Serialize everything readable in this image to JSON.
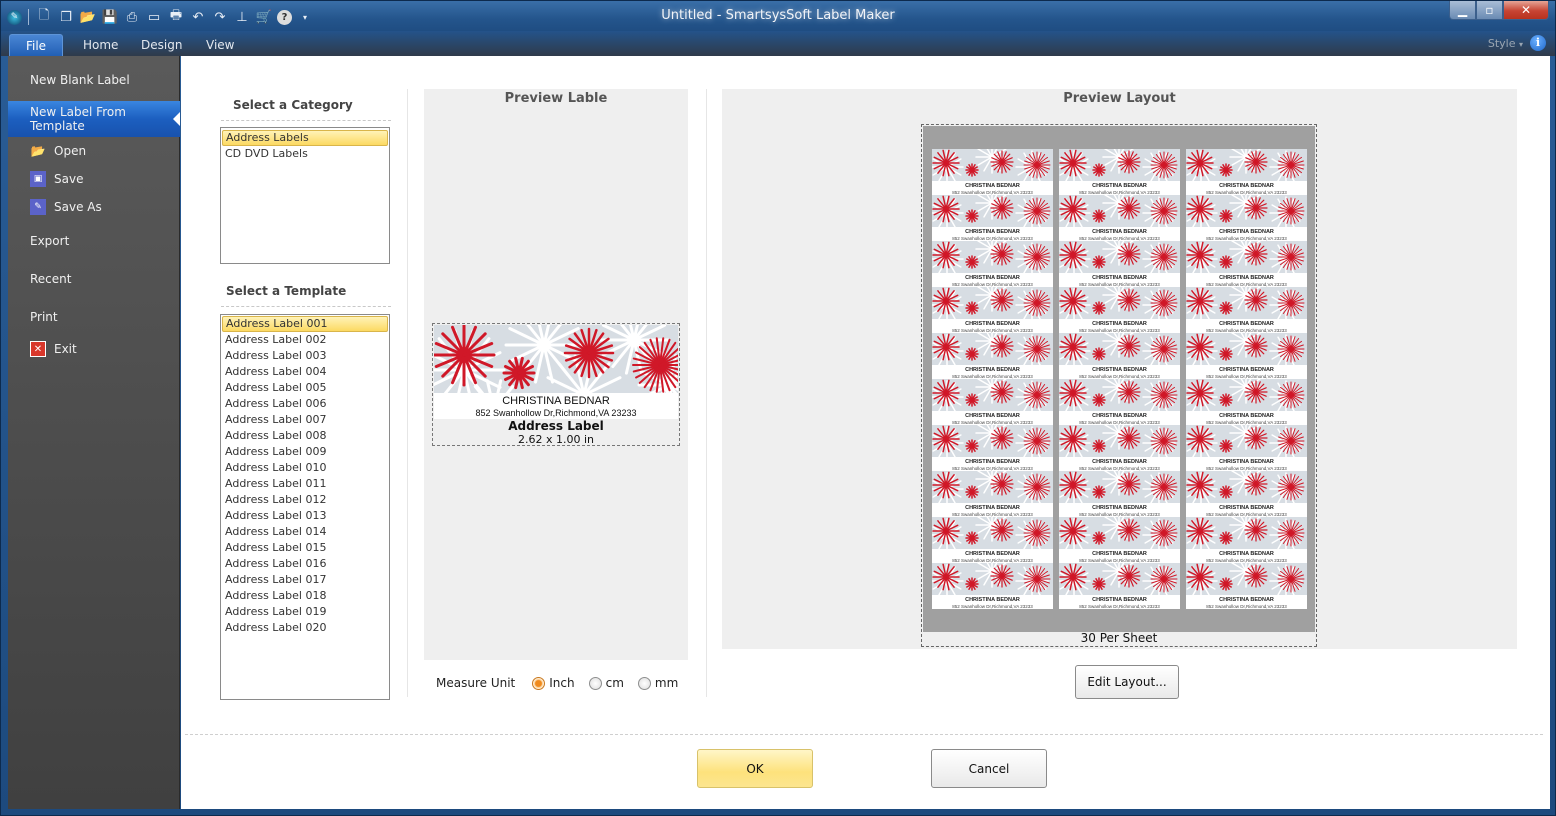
{
  "window": {
    "title": "Untitled - SmartsysSoft Label Maker",
    "controls": [
      "minimize",
      "maximize",
      "close"
    ]
  },
  "quick_access": {
    "icons": [
      "app-logo-icon",
      "new-icon",
      "new-from-template-icon",
      "open-icon",
      "save-icon",
      "pdf-icon",
      "label-icon",
      "print-icon",
      "undo-icon",
      "redo-icon",
      "stamp-icon",
      "cart-icon",
      "help-icon",
      "customize-dropdown-icon"
    ]
  },
  "ribbon": {
    "tabs": [
      {
        "label": "File",
        "active": true
      },
      {
        "label": "Home"
      },
      {
        "label": "Design"
      },
      {
        "label": "View"
      }
    ],
    "style_label": "Style",
    "info_glyph": "i"
  },
  "backstage": {
    "items": [
      {
        "label": "New Blank Label"
      },
      {
        "label": "New Label From Template",
        "active": true
      },
      {
        "label": "Open",
        "icon": "folder-icon"
      },
      {
        "label": "Save",
        "icon": "floppy-icon"
      },
      {
        "label": "Save As",
        "icon": "save-as-icon"
      },
      {
        "label": "Export"
      },
      {
        "label": "Recent"
      },
      {
        "label": "Print"
      },
      {
        "label": "Exit",
        "icon": "exit-icon"
      }
    ]
  },
  "category": {
    "heading": "Select a Category",
    "items": [
      "Address Labels",
      "CD DVD Labels"
    ],
    "selected": "Address Labels"
  },
  "template": {
    "heading": "Select a Template",
    "items": [
      "Address Label 001",
      "Address Label 002",
      "Address Label 003",
      "Address Label 004",
      "Address Label 005",
      "Address Label 006",
      "Address Label 007",
      "Address Label 008",
      "Address Label 009",
      "Address Label 010",
      "Address Label 011",
      "Address Label 012",
      "Address Label 013",
      "Address Label 014",
      "Address Label 015",
      "Address Label 016",
      "Address Label 017",
      "Address Label 018",
      "Address Label 019",
      "Address Label 020"
    ],
    "selected": "Address Label 001"
  },
  "preview_label": {
    "heading": "Preview Lable",
    "name": "CHRISTINA BEDNAR",
    "address": "852 Swanhollow Dr,Richmond,VA 23233",
    "type": "Address Label",
    "size": "2.62 x 1.00 in"
  },
  "measure_unit": {
    "label": "Measure Unit",
    "options": [
      "Inch",
      "cm",
      "mm"
    ],
    "selected": "Inch"
  },
  "preview_layout": {
    "heading": "Preview Layout",
    "columns": 3,
    "rows": 10,
    "per_sheet": "30 Per Sheet",
    "mini_name": "CHRISTINA BEDNAR",
    "mini_address": "852 Swanhollow Dr,Richmond,VA 23233",
    "edit_button": "Edit Layout..."
  },
  "footer": {
    "ok": "OK",
    "cancel": "Cancel"
  },
  "colors": {
    "accent_blue": "#1c5fc0",
    "selection_yellow": "#fcd962",
    "flower_red": "#d01828"
  }
}
